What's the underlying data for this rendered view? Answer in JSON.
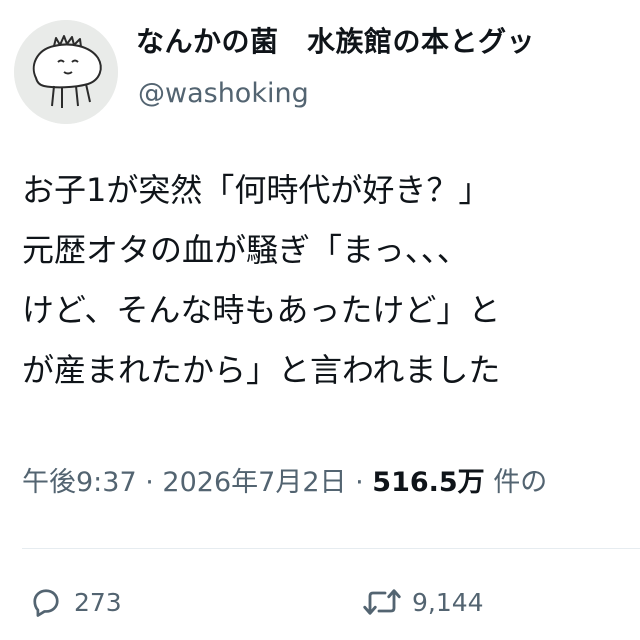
{
  "author": {
    "display_name": "なんかの菌　水族館の本とグッ",
    "handle": "@washoking"
  },
  "post": {
    "lines": [
      "お子1が突然「何時代が好き？」",
      "元歴オタの血が騒ぎ「まっ、、、",
      "けど、そんな時もあったけど」と",
      "が産まれたから」と言われました"
    ]
  },
  "meta": {
    "time": "午後9:37",
    "separator": "·",
    "date": "2026年7月2日",
    "views_count": "516.5万",
    "views_label": "件の"
  },
  "actions": {
    "reply_count": "273",
    "retweet_count": "9,144"
  },
  "icons": {
    "avatar": "creature-drawing-avatar",
    "reply": "speech-bubble-icon",
    "retweet": "retweet-arrows-icon"
  },
  "colors": {
    "text_primary": "#0f1419",
    "text_secondary": "#536471",
    "divider": "#e6ecf0"
  }
}
